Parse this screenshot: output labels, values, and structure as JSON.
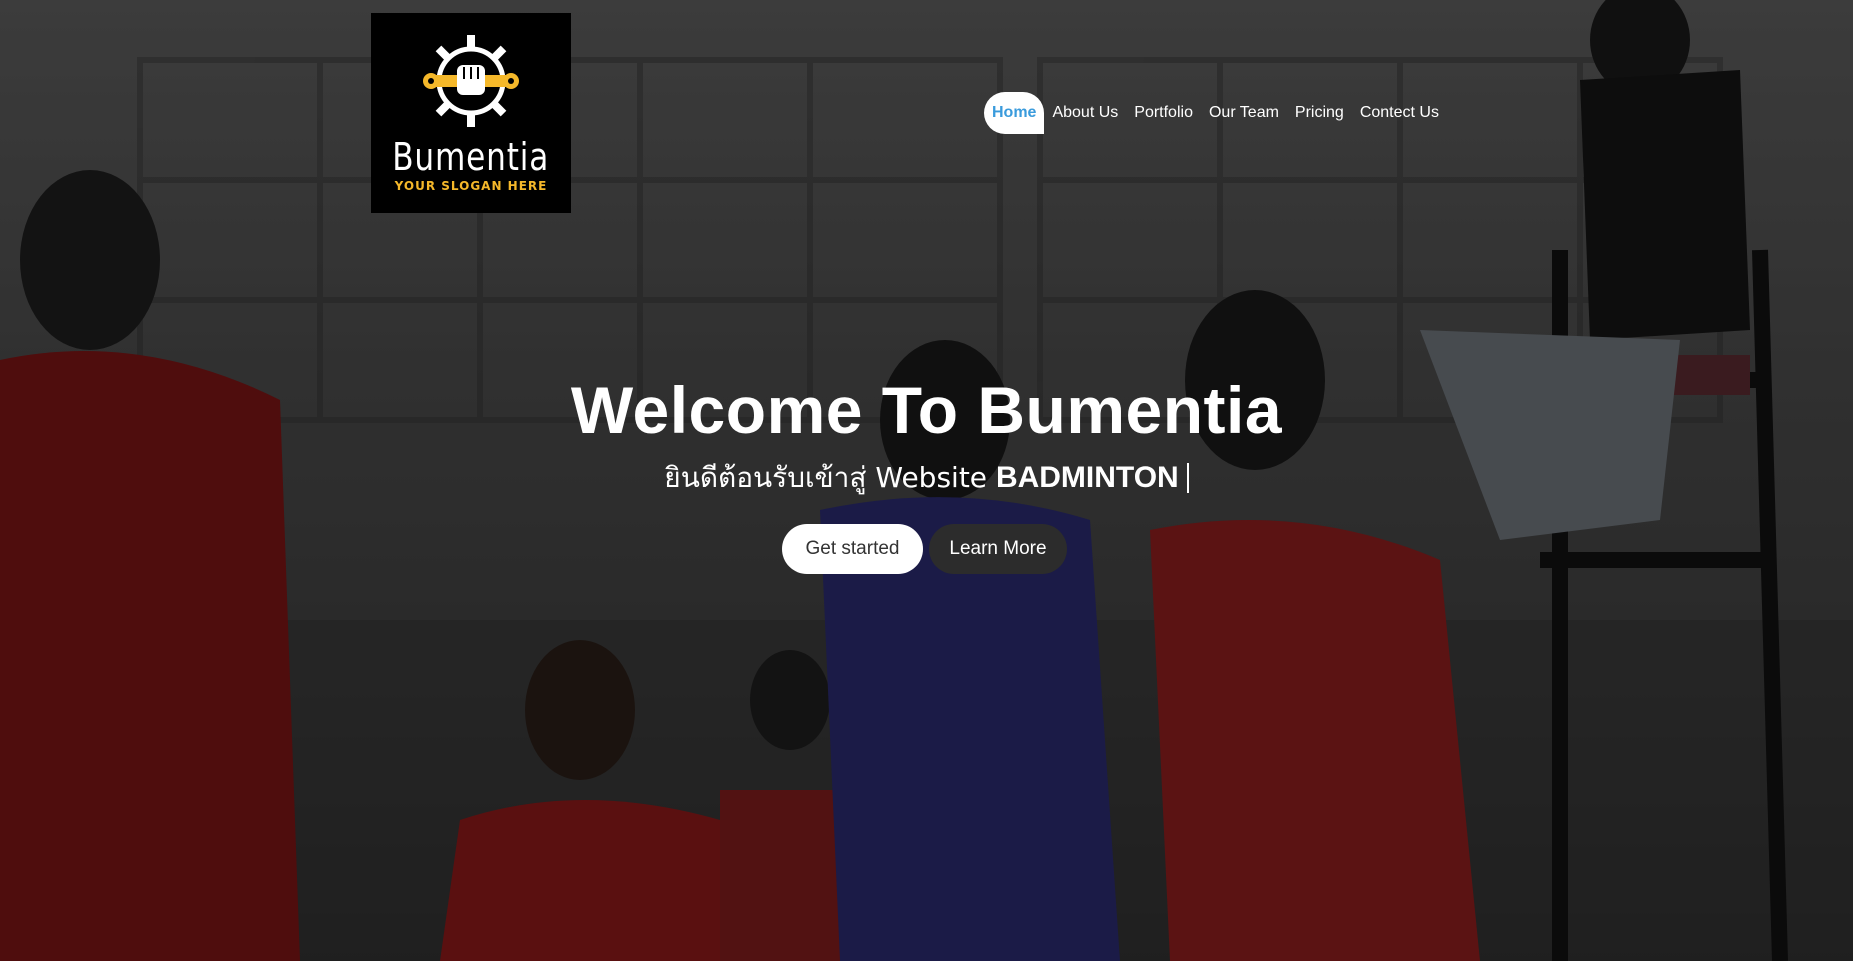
{
  "brand": {
    "name": "Bumentia",
    "slogan": "YOUR SLOGAN HERE",
    "accent_color": "#f5b82a"
  },
  "nav": {
    "items": [
      {
        "label": "Home",
        "active": true
      },
      {
        "label": "About Us"
      },
      {
        "label": "Portfolio"
      },
      {
        "label": "Our Team"
      },
      {
        "label": "Pricing"
      },
      {
        "label": "Contect Us"
      }
    ],
    "active_color": "#3a9bdc"
  },
  "hero": {
    "title": "Welcome To Bumentia",
    "subtitle_thai": "ยินดีต้อนรับเข้าสู่",
    "subtitle_site": "Website",
    "subtitle_strong": "BADMINTON",
    "buttons": {
      "primary": "Get started",
      "secondary": "Learn More"
    }
  }
}
